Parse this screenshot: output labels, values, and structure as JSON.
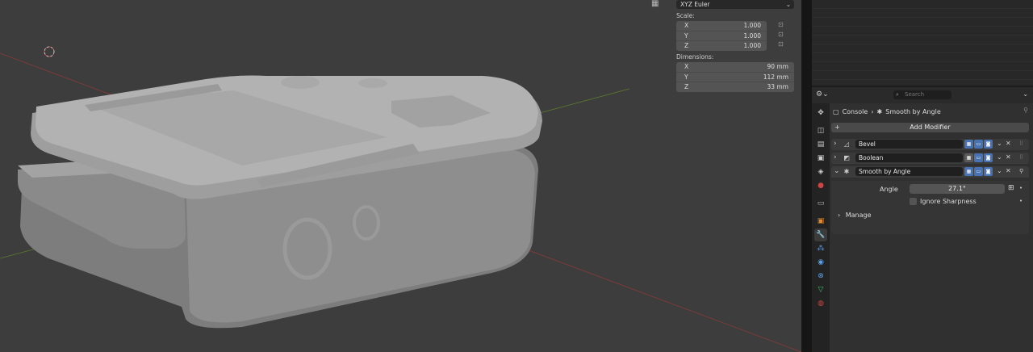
{
  "npanel": {
    "rotation_mode": "XYZ Euler",
    "scale_label": "Scale:",
    "scale": [
      {
        "axis": "X",
        "value": "1.000"
      },
      {
        "axis": "Y",
        "value": "1.000"
      },
      {
        "axis": "Z",
        "value": "1.000"
      }
    ],
    "dimensions_label": "Dimensions:",
    "dimensions": [
      {
        "axis": "X",
        "value": "90 mm"
      },
      {
        "axis": "Y",
        "value": "112 mm"
      },
      {
        "axis": "Z",
        "value": "33 mm"
      }
    ]
  },
  "properties": {
    "search_placeholder": "Search",
    "breadcrumb": {
      "object": "Console",
      "modifier": "Smooth by Angle"
    },
    "add_modifier": "Add Modifier",
    "modifiers": [
      {
        "name": "Bevel",
        "expanded": false,
        "icon": "bevel-icon"
      },
      {
        "name": "Boolean",
        "expanded": false,
        "icon": "boolean-icon"
      },
      {
        "name": "Smooth by Angle",
        "expanded": true,
        "icon": "geometry-nodes-icon"
      }
    ],
    "angle_label": "Angle",
    "angle_value": "27.1°",
    "ignore_sharpness_label": "Ignore Sharpness",
    "manage_label": "Manage"
  },
  "colors": {
    "accent": "#4772b3",
    "viewport_bg": "#3d3d3d",
    "panel_bg": "#303030"
  }
}
